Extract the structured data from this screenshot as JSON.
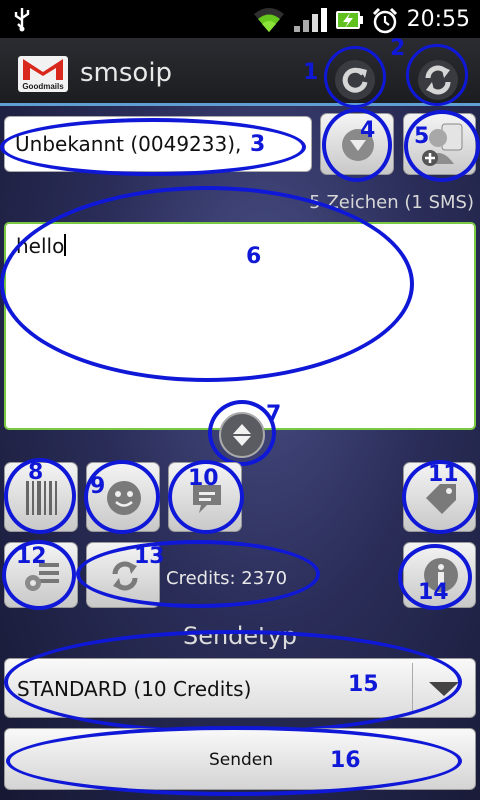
{
  "status_bar": {
    "time": "20:55",
    "icons": [
      "usb-icon",
      "wifi-icon",
      "signal-icon",
      "battery-charging-icon",
      "alarm-icon"
    ]
  },
  "title_bar": {
    "app_name": "smsoip",
    "logo_text": "Goodmails",
    "accent_color": "#5f9fd3"
  },
  "annotations": {
    "color": "#1018d8",
    "labels": [
      "1",
      "2",
      "3",
      "4",
      "5",
      "6",
      "7",
      "8",
      "9",
      "10",
      "11",
      "12",
      "13",
      "14",
      "15",
      "16"
    ]
  },
  "recipient": {
    "value": "Unbekannt (0049233),"
  },
  "message": {
    "char_count": "5 Zeichen (1 SMS)",
    "text": "hello"
  },
  "credits": {
    "text": "Credits: 2370"
  },
  "send_type": {
    "label": "Sendetyp",
    "selected": "STANDARD (10 Credits)"
  },
  "send_button": {
    "label": "Senden"
  },
  "colors": {
    "input_border_active": "#7ac943"
  }
}
